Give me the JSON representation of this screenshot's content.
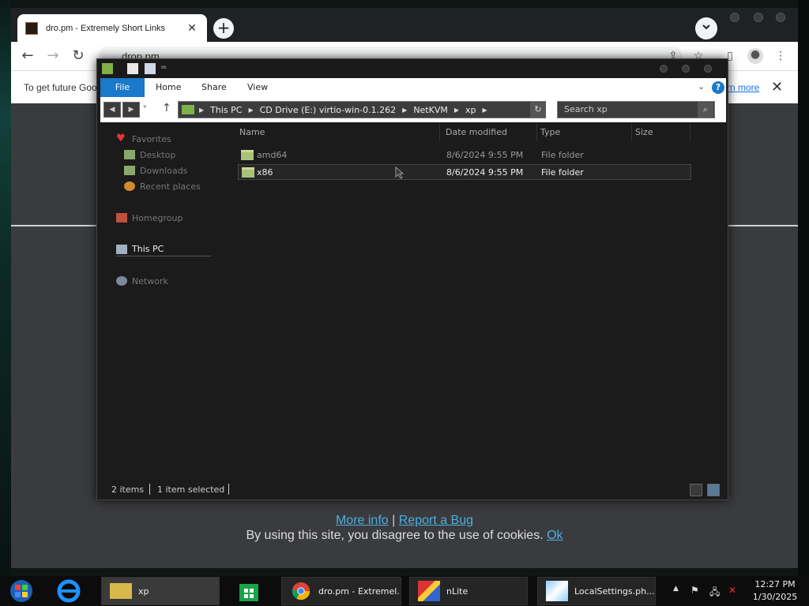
{
  "browser": {
    "tab_title": "dro.pm - Extremely Short Links",
    "new_tab": "+",
    "close": "✕",
    "url": "drop.pm",
    "infobar_text": "To get future Goog",
    "infobar_link": "rn more",
    "infobar_close": "✕"
  },
  "site": {
    "more_info": "More info",
    "separator": "|",
    "report_bug": "Report a Bug",
    "cookie_text": "By using this site, you disagree to the use of cookies.",
    "ok": "Ok"
  },
  "explorer": {
    "ribbon_tabs": [
      "File",
      "Home",
      "Share",
      "View"
    ],
    "address": [
      "This PC",
      "CD Drive (E:) virtio-win-0.1.262",
      "NetKVM",
      "xp"
    ],
    "search_placeholder": "Search xp",
    "nav": {
      "favorites": "Favorites",
      "desktop": "Desktop",
      "downloads": "Downloads",
      "recent": "Recent places",
      "homegroup": "Homegroup",
      "this_pc": "This PC",
      "network": "Network"
    },
    "columns": [
      "Name",
      "Date modified",
      "Type",
      "Size"
    ],
    "files": [
      {
        "name": "amd64",
        "date": "8/6/2024 9:55 PM",
        "type": "File folder"
      },
      {
        "name": "x86",
        "date": "8/6/2024 9:55 PM",
        "type": "File folder"
      }
    ],
    "status": {
      "items": "2 items",
      "selected": "1 item selected"
    }
  },
  "taskbar": {
    "items": [
      {
        "label": "xp"
      },
      {
        "label": "dro.pm - Extremel..."
      },
      {
        "label": "nLite"
      },
      {
        "label": "LocalSettings.ph..."
      }
    ],
    "tray_chevron": "▲",
    "time": "12:27 PM",
    "date": "1/30/2025"
  }
}
